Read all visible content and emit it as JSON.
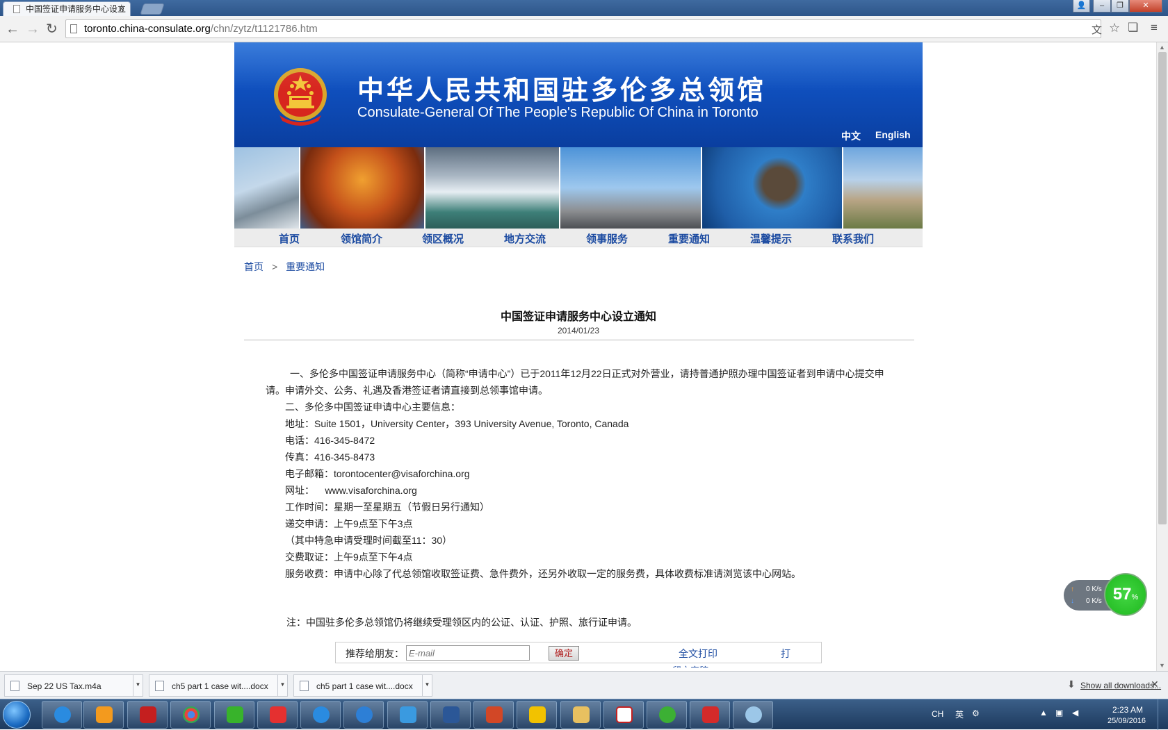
{
  "browser": {
    "tab_title": "中国签证申请服务中心设立",
    "url_host": "toronto.china-consulate.org",
    "url_path": "/chn/zytz/t1121786.htm"
  },
  "site": {
    "title_cn": "中华人民共和国驻多伦多总领馆",
    "title_en": "Consulate-General Of The People's Republic Of China in Toronto",
    "lang_cn": "中文",
    "lang_en": "English",
    "nav": [
      "首页",
      "领馆简介",
      "领区概况",
      "地方交流",
      "领事服务",
      "重要通知",
      "温馨提示",
      "联系我们"
    ],
    "breadcrumb": [
      "首页",
      "重要通知"
    ],
    "breadcrumb_sep": ">"
  },
  "article": {
    "title": "中国签证申请服务中心设立通知",
    "date": "2014/01/23",
    "para1": "一、多伦多中国签证申请服务中心（简称“申请中心”）已于2011年12月22日正式对外营业，请持普通护照办理中国签证者到申请中心提交申请。申请外交、公务、礼遇及香港签证者请直接到总领事馆申请。",
    "lines": [
      "二、多伦多中国签证申请中心主要信息：",
      "地址：Suite 1501，University Center，393 University Avenue, Toronto, Canada",
      "电话：416-345-8472",
      "传真：416-345-8473",
      "电子邮箱：torontocenter@visaforchina.org",
      "网址：    www.visaforchina.org",
      "工作时间：星期一至星期五（节假日另行通知）",
      "递交申请：上午9点至下午3点",
      "（其中特急申请受理时间截至11：30）",
      "交费取证：上午9点至下午4点",
      "服务收费：申请中心除了代总领馆收取签证费、急件费外，还另外收取一定的服务费，具体收费标准请浏览该中心网站。"
    ],
    "note": "注：中国驻多伦多总领馆仍将继续受理领区内的公证、认证、护照、旅行证申请。"
  },
  "share": {
    "label": "推荐给朋友：",
    "placeholder": "E-mail",
    "button": "确定",
    "print_all": "全文打印",
    "print_short": "打",
    "print_cut": "印文字稿"
  },
  "speed_widget": {
    "up": "0 K/s",
    "down": "0 K/s",
    "percent": "57",
    "percent_unit": "%"
  },
  "downloads": {
    "items": [
      "Sep 22 US Tax.m4a",
      "ch5 part 1 case wit....docx",
      "ch5 part 1 case wit....docx"
    ],
    "show_all": "Show all downloads..."
  },
  "taskbar": {
    "lang": "CH",
    "ime": "英",
    "time": "2:23 AM",
    "date": "25/09/2016"
  },
  "colors": {
    "banner_blue": "#0f4fbd",
    "link_blue": "#1c4ba1",
    "speed_green": "#1eb81e"
  }
}
